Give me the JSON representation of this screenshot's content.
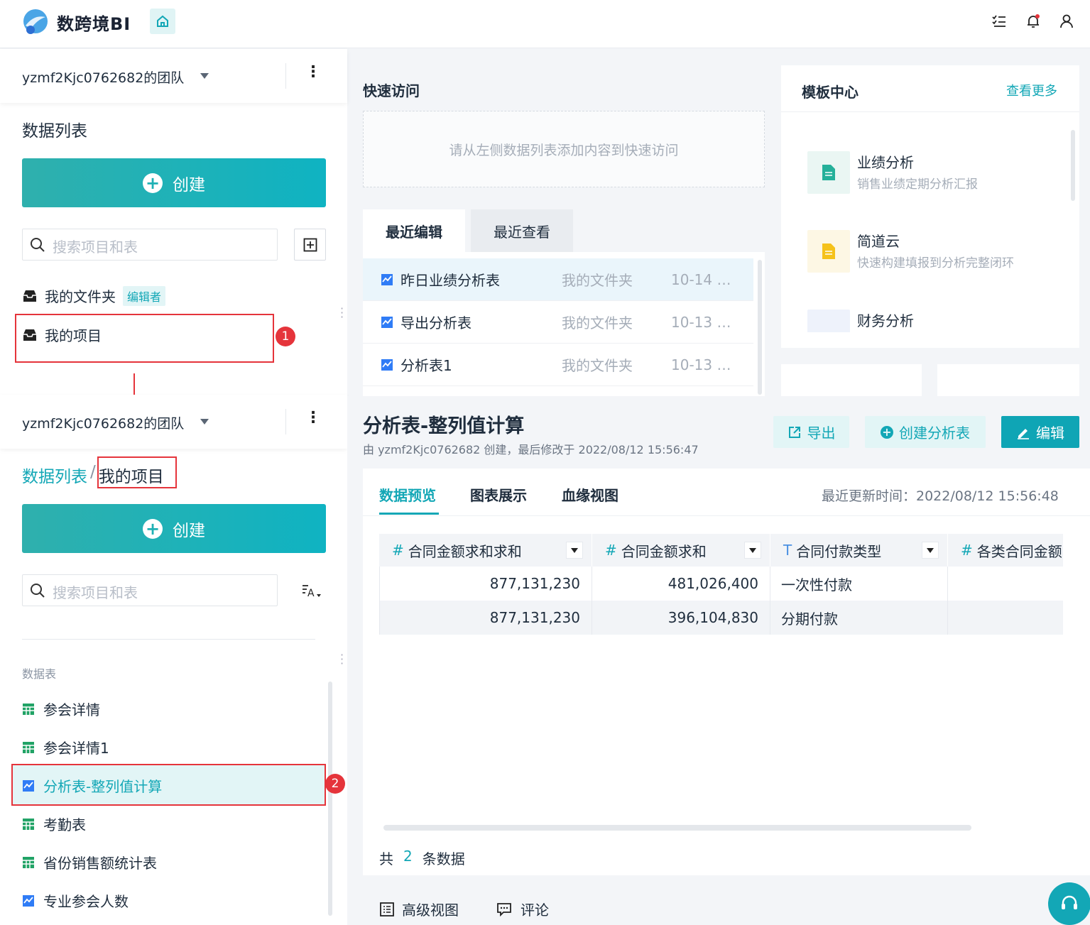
{
  "app": {
    "name": "数跨境BI"
  },
  "sidebar_top": {
    "team": "yzmf2Kjc0762682的团队",
    "title": "数据列表",
    "create_label": "创建",
    "search_placeholder": "搜索项目和表",
    "folders": [
      {
        "label": "我的文件夹",
        "tag": "编辑者"
      },
      {
        "label": "我的项目"
      }
    ],
    "badge": "1"
  },
  "sidebar_bottom": {
    "team": "yzmf2Kjc0762682的团队",
    "breadcrumb_root": "数据列表",
    "breadcrumb_sep": "/",
    "breadcrumb_current": "我的项目",
    "create_label": "创建",
    "search_placeholder": "搜索项目和表",
    "section_label": "数据表",
    "items": [
      {
        "label": "参会详情",
        "icon": "table-icon"
      },
      {
        "label": "参会详情1",
        "icon": "table-icon"
      },
      {
        "label": "分析表-整列值计算",
        "icon": "analysis-icon"
      },
      {
        "label": "考勤表",
        "icon": "table-icon"
      },
      {
        "label": "省份销售额统计表",
        "icon": "table-icon"
      },
      {
        "label": "专业参会人数",
        "icon": "analysis-icon"
      }
    ],
    "badge": "2"
  },
  "quick_access": {
    "title": "快速访问",
    "empty_hint": "请从左侧数据列表添加内容到快速访问",
    "tabs": [
      "最近编辑",
      "最近查看"
    ],
    "rows": [
      {
        "name": "昨日业绩分析表",
        "folder": "我的文件夹",
        "date": "10-14 …"
      },
      {
        "name": "导出分析表",
        "folder": "我的文件夹",
        "date": "10-13 …"
      },
      {
        "name": "分析表1",
        "folder": "我的文件夹",
        "date": "10-13 …"
      }
    ]
  },
  "templates": {
    "title": "模板中心",
    "more": "查看更多",
    "items": [
      {
        "name": "业绩分析",
        "desc": "销售业绩定期分析汇报"
      },
      {
        "name": "简道云",
        "desc": "快速构建填报到分析完整闭环"
      },
      {
        "name": "财务分析",
        "desc": ""
      }
    ]
  },
  "detail": {
    "title": "分析表-整列值计算",
    "meta": "由 yzmf2Kjc0762682 创建，最后修改于 2022/08/12 15:56:47",
    "export_label": "导出",
    "create_analysis_label": "创建分析表",
    "edit_label": "编辑",
    "tabs": [
      "数据预览",
      "图表展示",
      "血缘视图"
    ],
    "updated": "最近更新时间：2022/08/12 15:56:48",
    "columns": [
      {
        "type": "#",
        "name": "合同金额求和求和"
      },
      {
        "type": "#",
        "name": "合同金额求和"
      },
      {
        "type": "T",
        "name": "合同付款类型"
      },
      {
        "type": "#",
        "name": "各类合同金额"
      }
    ],
    "rows": [
      [
        "877,131,230",
        "481,026,400",
        "一次性付款",
        ""
      ],
      [
        "877,131,230",
        "396,104,830",
        "分期付款",
        ""
      ]
    ],
    "count_prefix": "共",
    "count": "2",
    "count_suffix": "条数据",
    "footer_actions": [
      "高级视图",
      "评论"
    ]
  },
  "colors": {
    "accent": "#13a7b6",
    "danger": "#e5343b",
    "brand_dark": "#1a2233"
  }
}
